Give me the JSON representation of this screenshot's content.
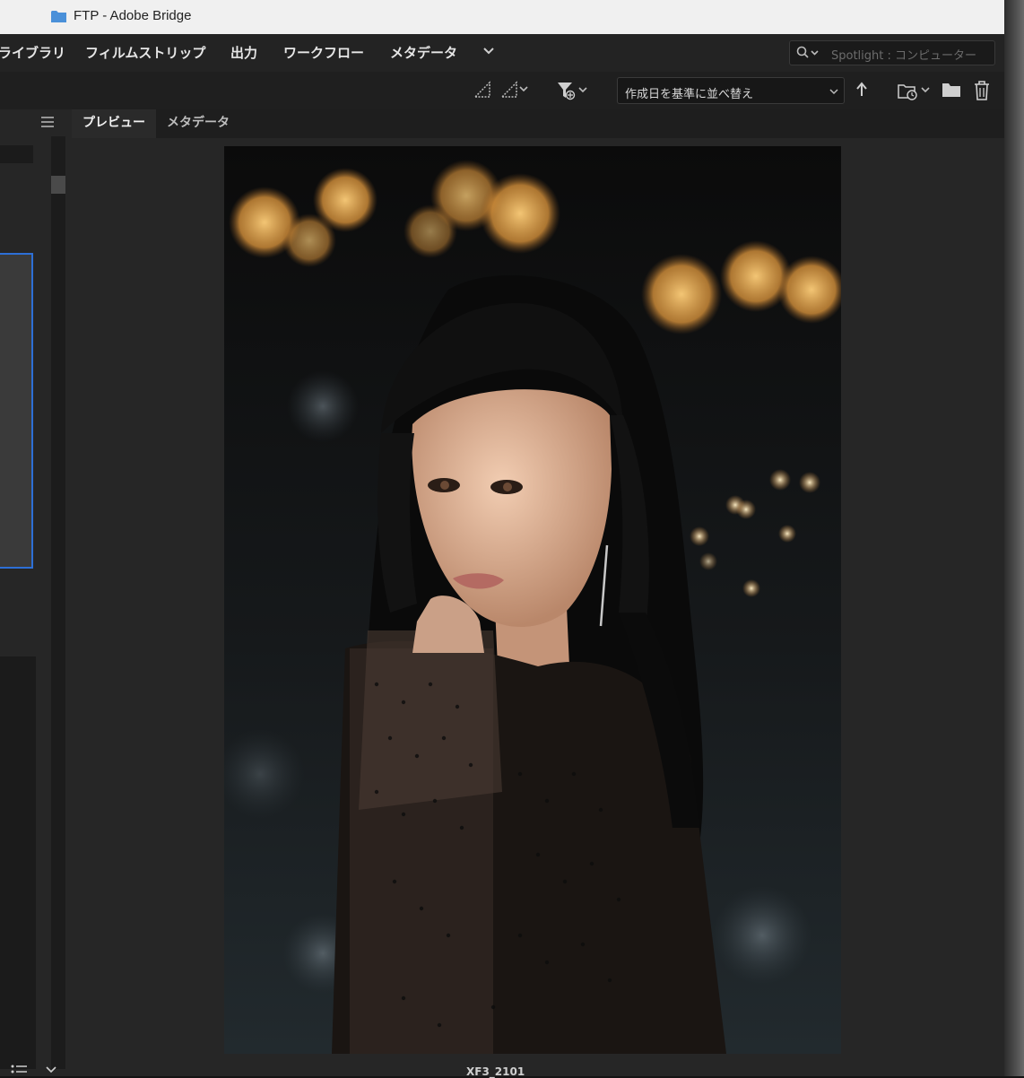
{
  "window": {
    "title": "FTP - Adobe Bridge"
  },
  "menubar": {
    "items": [
      "ライブラリ",
      "フィルムストリップ",
      "出力",
      "ワークフロー",
      "メタデータ"
    ],
    "search_placeholder": "Spotlight : コンピューター"
  },
  "toolbar": {
    "sort_label": "作成日を基準に並べ替え"
  },
  "tabs": [
    {
      "label": "プレビュー",
      "active": true
    },
    {
      "label": "メタデータ",
      "active": false
    }
  ],
  "preview": {
    "caption": "XF3_2101"
  },
  "icons": {
    "folder": "folder-icon",
    "more": "chevron-down-icon",
    "search": "search-icon",
    "quality": "quality-icon",
    "filter": "filter-icon",
    "sort_direction": "arrow-up-icon",
    "recent_folder": "recent-folder-icon",
    "new_folder": "new-folder-icon",
    "delete": "trash-icon",
    "panel_menu": "panel-menu-icon"
  },
  "colors": {
    "accent": "#2d6fd6",
    "menubar_bg": "#232323",
    "panel_bg": "#262626"
  }
}
